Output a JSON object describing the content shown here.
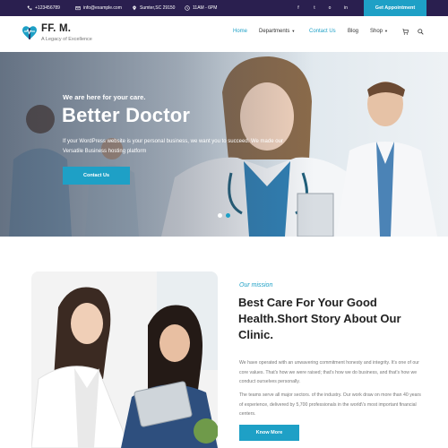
{
  "topbar": {
    "phone": "+123456789",
    "email": "info@example.com",
    "address": "Sumter,SC 29150",
    "hours": "11AM - 6PM",
    "social": [
      "f",
      "t",
      "o",
      "in"
    ],
    "cta": "Get Appointment"
  },
  "brand": {
    "name": "FF. M.",
    "tagline": "A Legacy of Excellence"
  },
  "nav": {
    "items": [
      {
        "label": "Home"
      },
      {
        "label": "Departments"
      },
      {
        "label": "Contact Us"
      },
      {
        "label": "Blog"
      },
      {
        "label": "Shop"
      }
    ],
    "icons": [
      "cart-icon",
      "search-icon"
    ]
  },
  "hero": {
    "kicker": "We are here for your care.",
    "title": "Better Doctor",
    "text": "If your WordPress website is your personal business, we want you to succeed. We made our Versatile Business hosting platform",
    "button": "Contact Us",
    "slides": 2,
    "active_slide": 1
  },
  "mission": {
    "kicker": "Our mission",
    "title": "Best Care For Your Good Health.Short Story About Our Clinic.",
    "paragraph1": "We have operated with an unwavering commitment honesty and integrity. It's one of our core values. That's how we were raised; that's how we do business, and that's how we conduct ourselves personally.",
    "paragraph2": "The teams serve all major sectors. of the industry. Our work draw on more than 40 years of experience, delivered by 5,700 professionals in the world\\'s most important financial centers.",
    "button": "Know More"
  },
  "colors": {
    "topbar": "#2a1f4f",
    "accent": "#1ea0c6",
    "text_dark": "#222222",
    "text_muted": "#777777"
  }
}
